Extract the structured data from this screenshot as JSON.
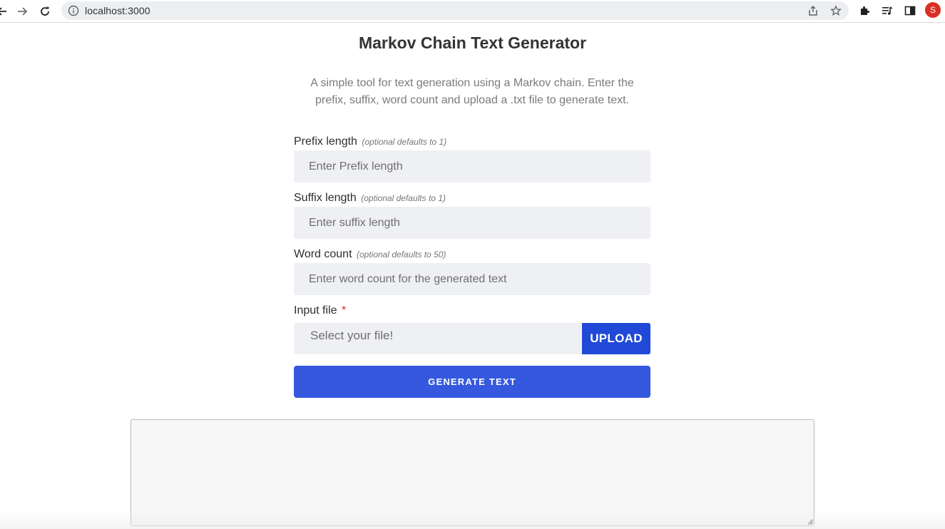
{
  "browser": {
    "url": "localhost:3000",
    "profile_initial": "S",
    "icons": [
      "back-arrow-icon",
      "forward-arrow-icon",
      "reload-icon",
      "info-icon",
      "share-icon",
      "star-icon",
      "extensions-icon",
      "reading-list-icon",
      "side-panel-icon"
    ]
  },
  "page": {
    "title": "Markov Chain Text Generator",
    "description": "A simple tool for text generation using a Markov chain. Enter the prefix, suffix, word count and upload a .txt file to generate text."
  },
  "form": {
    "prefix": {
      "label": "Prefix length",
      "hint": "(optional defaults to 1)",
      "placeholder": "Enter Prefix length",
      "value": ""
    },
    "suffix": {
      "label": "Suffix length",
      "hint": "(optional defaults to 1)",
      "placeholder": "Enter suffix length",
      "value": ""
    },
    "word_count": {
      "label": "Word count",
      "hint": "(optional defaults to 50)",
      "placeholder": "Enter word count for the generated text",
      "value": ""
    },
    "input_file": {
      "label": "Input file",
      "required_marker": "*",
      "placeholder": "Select your file!",
      "upload_label": "UPLOAD"
    },
    "generate_label": "GENERATE TEXT"
  },
  "output": {
    "value": ""
  },
  "colors": {
    "primary": "#3558de",
    "upload": "#1f49d6",
    "input_bg": "#eff0f3",
    "required": "#e02424",
    "profile": "#d93025"
  }
}
